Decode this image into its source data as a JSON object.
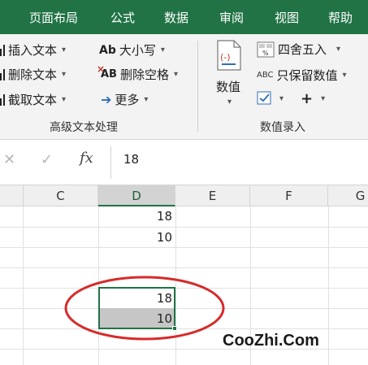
{
  "ribbon_tabs": [
    "页面布局",
    "公式",
    "数据",
    "审阅",
    "视图",
    "帮助"
  ],
  "groups": {
    "text": {
      "label": "高级文本处理",
      "items": {
        "insert": "插入文本",
        "delete": "删除文本",
        "extract": "截取文本",
        "case": "大小写",
        "remove_spaces": "删除空格",
        "more": "更多"
      }
    },
    "number": {
      "label": "数值录入",
      "big_button": "数值",
      "items": {
        "round": "四舍五入",
        "keep_values": "只保留数值"
      }
    }
  },
  "icons": {
    "case": "Ab",
    "remove_spaces": "AB",
    "keep_values": "ABC",
    "plus": "+"
  },
  "formula_bar": {
    "fx": "fx",
    "value": "18"
  },
  "columns": [
    "C",
    "D",
    "E",
    "F",
    "G"
  ],
  "selected_column": "D",
  "cells": {
    "d_row1": "18",
    "d_row2": "10",
    "d_sel1": "18",
    "d_sel2": "10"
  },
  "watermark": "CooZhi.Com",
  "colors": {
    "ribbon_green": "#217346",
    "circle_red": "#d62b2b"
  }
}
